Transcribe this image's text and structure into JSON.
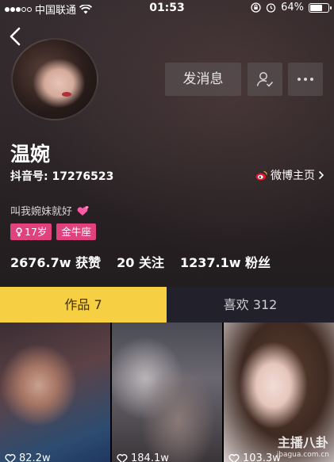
{
  "status_bar": {
    "carrier": "中国联通",
    "time": "01:53",
    "battery": "64%",
    "battery_level": 0.64
  },
  "profile": {
    "name": "温婉",
    "douyin_id": "抖音号: 17276523",
    "weibo_link": "微博主页",
    "bio": "叫我婉妹就好",
    "tags": {
      "age": "17岁",
      "zodiac": "金牛座"
    },
    "stats": {
      "likes": "2676.7w 获赞",
      "following": "20 关注",
      "followers": "1237.1w 粉丝"
    }
  },
  "actions": {
    "message_label": "发消息"
  },
  "tabs": {
    "works": "作品 7",
    "likes": "喜欢 312"
  },
  "videos": [
    {
      "likes": "82.2w"
    },
    {
      "likes": "184.1w"
    },
    {
      "likes": "103.3w"
    }
  ],
  "watermark": {
    "title": "主播八卦",
    "url": "ibagua.com.cn"
  },
  "colors": {
    "active_tab": "#f6cf42",
    "tag": "#e0427e"
  },
  "icons": [
    "back-arrow-icon",
    "wifi-icon",
    "signal-dots-icon",
    "lock-rotation-icon",
    "alarm-icon",
    "battery-icon",
    "add-friend-icon",
    "more-icon",
    "weibo-icon",
    "chevron-right-icon",
    "heart-icon",
    "female-icon"
  ]
}
